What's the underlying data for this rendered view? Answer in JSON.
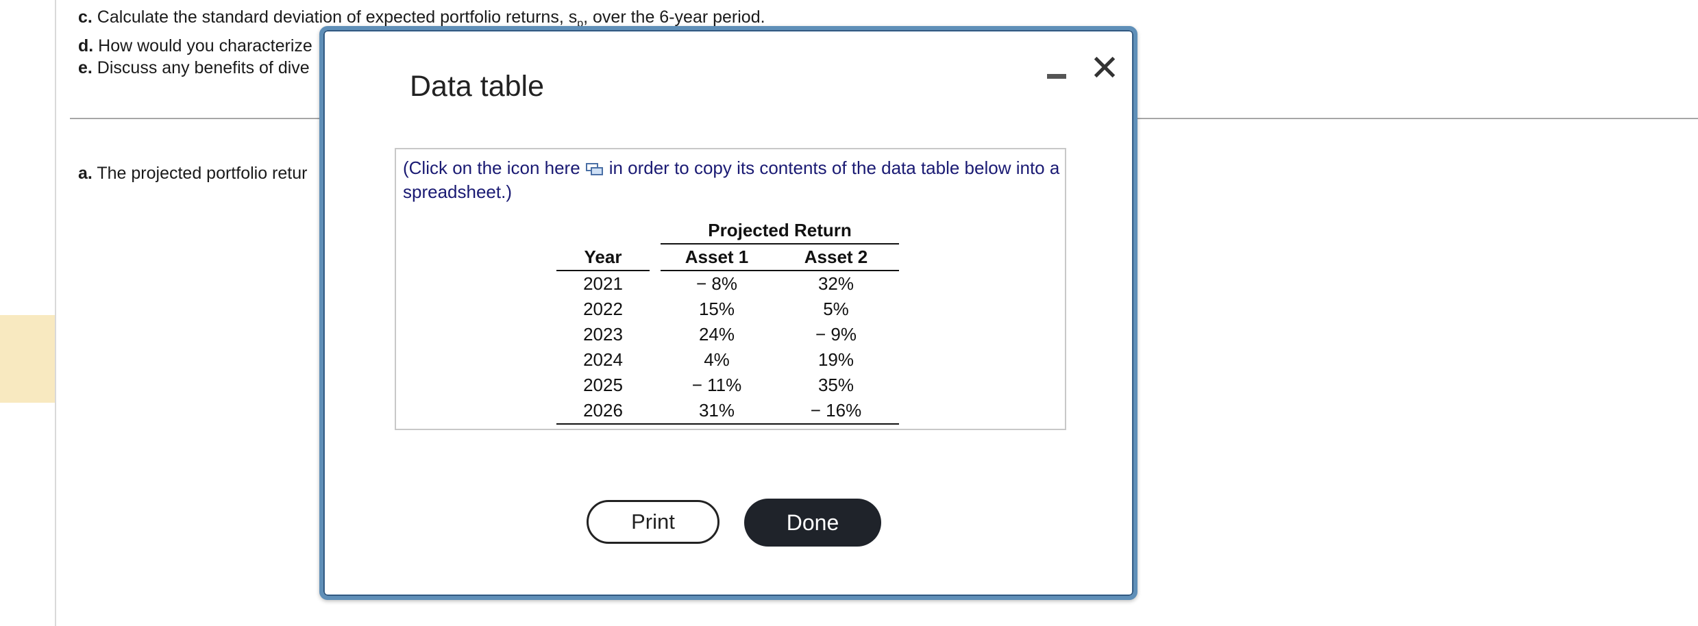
{
  "background": {
    "q_c_bold": "c.",
    "q_c": " Calculate the standard deviation of expected portfolio returns, s",
    "q_c_sub": "p",
    "q_c_tail": ", over the 6-year period.",
    "q_d_bold": "d.",
    "q_d": " How would you characterize",
    "q_e_bold": "e.",
    "q_e": " Discuss any benefits of dive",
    "ans_a_bold": "a.",
    "ans_a": " The projected portfolio retur"
  },
  "modal": {
    "title": "Data table",
    "minimize_icon": "minimize-icon",
    "close_symbol": "✕",
    "note_prefix": "(Click on the icon here",
    "note_suffix": "in order to copy its contents of the data table below into a spreadsheet.)",
    "table": {
      "group_header": "Projected Return",
      "headers": [
        "Year",
        "Asset 1",
        "Asset 2"
      ],
      "rows": [
        [
          "2021",
          "− 8%",
          "32%"
        ],
        [
          "2022",
          "15%",
          "5%"
        ],
        [
          "2023",
          "24%",
          "− 9%"
        ],
        [
          "2024",
          "4%",
          "19%"
        ],
        [
          "2025",
          "− 11%",
          "35%"
        ],
        [
          "2026",
          "31%",
          "− 16%"
        ]
      ]
    },
    "print_label": "Print",
    "done_label": "Done"
  },
  "colors": {
    "modal_border": "#5f8fb8",
    "note_text": "#1a1a73",
    "done_button": "#1f232a",
    "highlight": "#f8e9c0"
  }
}
